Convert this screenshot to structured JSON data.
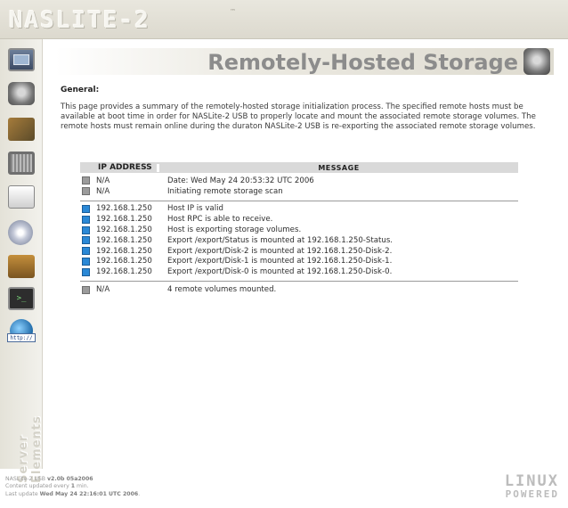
{
  "header": {
    "logo_text": "NASLITE-2",
    "logo_tm": "™"
  },
  "sidebar": {
    "items": [
      {
        "icon": "monitor-icon"
      },
      {
        "icon": "disk-icon"
      },
      {
        "icon": "network-icon"
      },
      {
        "icon": "chip-icon"
      },
      {
        "icon": "system-icon"
      },
      {
        "icon": "cd-icon"
      },
      {
        "icon": "package-icon"
      },
      {
        "icon": "terminal-icon",
        "label": ">_"
      },
      {
        "icon": "globe-icon"
      }
    ],
    "http_badge": "http://",
    "brand_text": "Server Elements"
  },
  "main": {
    "title": "Remotely-Hosted Storage",
    "section_label": "General:",
    "intro": "This page provides a summary of the remotely-hosted storage initialization process. The specified remote hosts must be available at boot time in order for NASLite-2 USB to properly locate and mount the associated remote storage volumes. The remote hosts must remain online during the duraton NASLite-2 USB is re-exporting the associated remote storage volumes.",
    "table": {
      "headers": {
        "ip": "IP ADDRESS",
        "message": "MESSAGE"
      },
      "group1": [
        {
          "status": "gray",
          "ip": "N/A",
          "message": "Date: Wed May 24 20:53:32 UTC 2006"
        },
        {
          "status": "gray",
          "ip": "N/A",
          "message": "Initiating remote storage scan"
        }
      ],
      "group2": [
        {
          "status": "blue",
          "ip": "192.168.1.250",
          "message": "Host IP is valid"
        },
        {
          "status": "blue",
          "ip": "192.168.1.250",
          "message": "Host RPC is able to receive."
        },
        {
          "status": "blue",
          "ip": "192.168.1.250",
          "message": "Host is exporting storage volumes."
        },
        {
          "status": "blue",
          "ip": "192.168.1.250",
          "message": "Export /export/Status is mounted at 192.168.1.250-Status."
        },
        {
          "status": "blue",
          "ip": "192.168.1.250",
          "message": "Export /export/Disk-2 is mounted at 192.168.1.250-Disk-2."
        },
        {
          "status": "blue",
          "ip": "192.168.1.250",
          "message": "Export /export/Disk-1 is mounted at 192.168.1.250-Disk-1."
        },
        {
          "status": "blue",
          "ip": "192.168.1.250",
          "message": "Export /export/Disk-0 is mounted at 192.168.1.250-Disk-0."
        }
      ],
      "group3": [
        {
          "status": "gray",
          "ip": "N/A",
          "message": "4 remote volumes mounted."
        }
      ]
    }
  },
  "footer": {
    "version_prefix": "NASLite-2 USB ",
    "version": "v2.0b 05a2006",
    "update_prefix": "Content updated every ",
    "update_value": "1",
    "update_suffix": " min.",
    "last_prefix": "Last update ",
    "last_value": "Wed May 24 22:16:01 UTC 2006",
    "last_suffix": "."
  },
  "powered": {
    "line1": "LINUX",
    "line2": "POWERED"
  },
  "colors": {
    "status_blue": "#2a88d6",
    "status_gray": "#9b9b9b"
  }
}
